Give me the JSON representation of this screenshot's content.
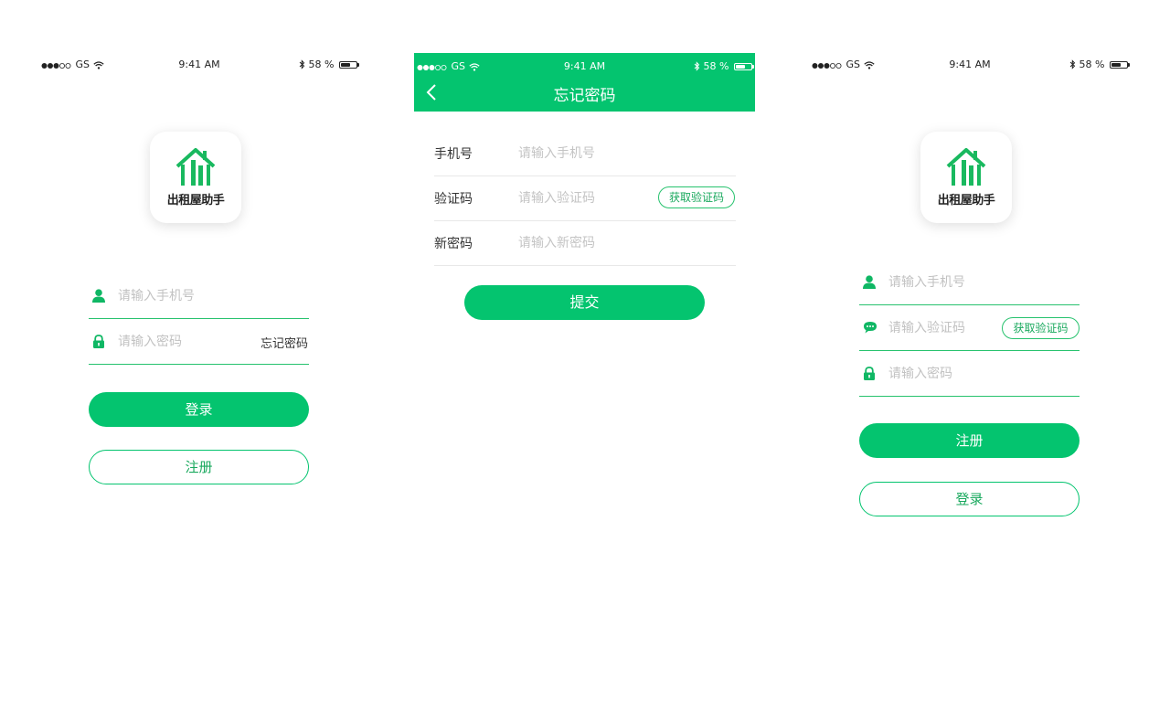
{
  "status_bar": {
    "carrier": "GS",
    "time": "9:41 AM",
    "battery": "58 %",
    "battery_level": 0.58
  },
  "brand": {
    "app_name": "出租屋助手",
    "accent": "#04c46f",
    "accent_text": "#1aa95e",
    "logo_house": "#19b95f"
  },
  "login": {
    "phone_placeholder": "请输入手机号",
    "password_placeholder": "请输入密码",
    "forgot_link": "忘记密码",
    "login_button": "登录",
    "register_button": "注册",
    "icons": [
      "user-icon",
      "lock-icon"
    ]
  },
  "forgot": {
    "title": "忘记密码",
    "phone_label": "手机号",
    "phone_placeholder": "请输入手机号",
    "code_label": "验证码",
    "code_placeholder": "请输入验证码",
    "get_code_button": "获取验证码",
    "new_password_label": "新密码",
    "new_password_placeholder": "请输入新密码",
    "submit_button": "提交",
    "icons": [
      "back-chevron-icon"
    ]
  },
  "register": {
    "phone_placeholder": "请输入手机号",
    "code_placeholder": "请输入验证码",
    "get_code_button": "获取验证码",
    "password_placeholder": "请输入密码",
    "register_button": "注册",
    "login_button": "登录",
    "icons": [
      "user-icon",
      "message-icon",
      "lock-icon"
    ]
  }
}
